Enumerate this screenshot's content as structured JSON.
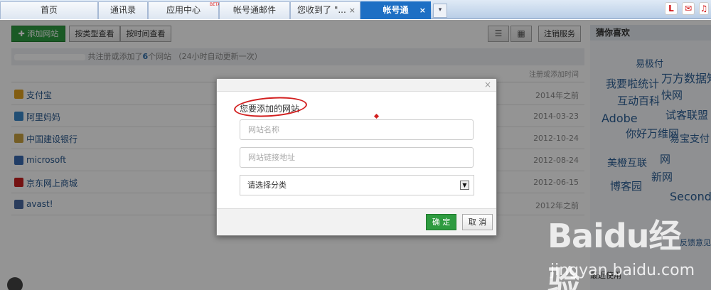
{
  "tabs": [
    {
      "label": "首页"
    },
    {
      "label": "通讯录"
    },
    {
      "label": "应用中心",
      "badge": "BETA"
    },
    {
      "label": "帐号通邮件"
    },
    {
      "label": "您收到了 \"...",
      "close": "×"
    },
    {
      "label": "帐号通",
      "close": "×"
    }
  ],
  "tab_more": "▾",
  "toolbar": {
    "add_site": "添加网站",
    "by_type": "按类型查看",
    "by_time": "按时间查看",
    "cancel_service": "注销服务"
  },
  "info": {
    "text_a": "共注册或添加了",
    "count": "6",
    "text_b": "个网站 （24小时自动更新一次）"
  },
  "list_header": "注册或添加时间",
  "sites": [
    {
      "name": "支付宝",
      "date": "2014年之前",
      "color": "#e0a020"
    },
    {
      "name": "阿里妈妈",
      "date": "2014-03-23",
      "color": "#3a87c8"
    },
    {
      "name": "中国建设银行",
      "date": "2012-10-24",
      "color": "#c8a040"
    },
    {
      "name": "microsoft",
      "date": "2012-08-24",
      "color": "#3a6ab0"
    },
    {
      "name": "京东网上商城",
      "date": "2012-06-15",
      "color": "#c82020"
    },
    {
      "name": "avast!",
      "date": "2012年之前",
      "color": "#4a6aa0"
    }
  ],
  "sidebar": {
    "title": "猜你喜欢",
    "cloud": [
      "易极付",
      "我要啦统计",
      "万方数据知",
      "互动百科",
      "快网",
      "Adobe",
      "试客联盟",
      "你好万维网",
      "易宝支付",
      "美橙互联",
      "网",
      "新网",
      "博客园",
      "Second"
    ],
    "feedback": "反馈意见",
    "recent": "最近使用"
  },
  "dialog": {
    "title": "您要添加的网站",
    "close": "×",
    "site_name_placeholder": "网站名称",
    "site_url_placeholder": "网站链接地址",
    "category_value": "请选择分类",
    "ok": "确 定",
    "cancel": "取 消"
  },
  "watermark": {
    "brand": "Baidu经验",
    "url": "jingyan.baidu.com"
  }
}
